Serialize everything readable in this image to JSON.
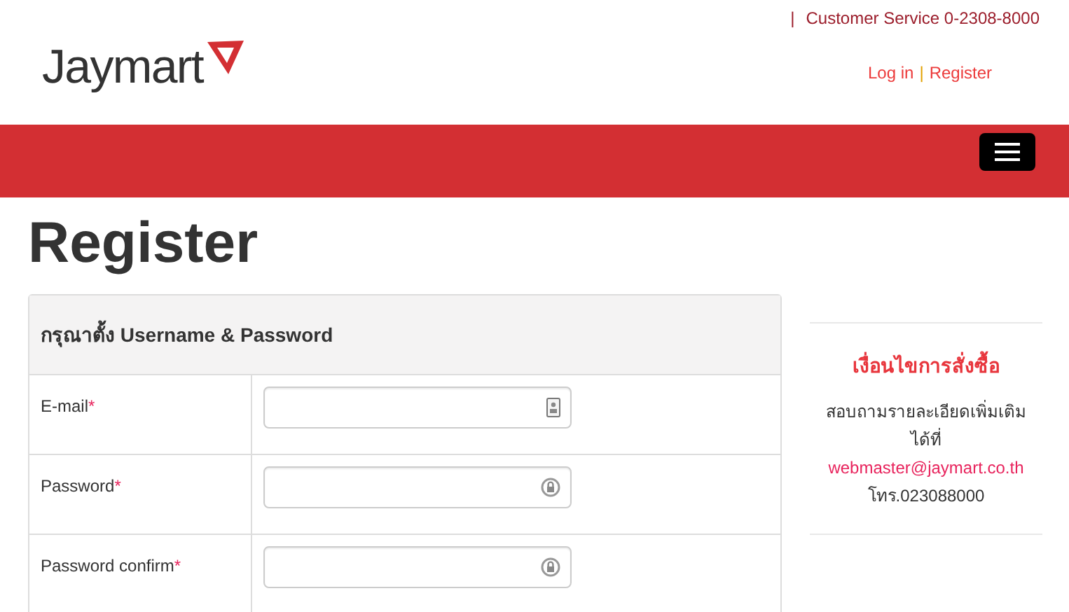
{
  "header": {
    "logo": "Jaymart",
    "separator": "|",
    "customer_service": "Customer Service 0-2308-8000",
    "links": [
      {
        "label": "Log in"
      },
      {
        "separator": "|",
        "label": "Register"
      }
    ]
  },
  "page_title": "Register",
  "form": {
    "heading": "กรุณาตั้ง Username & Password",
    "fields": [
      {
        "label": "E-mail",
        "required_mark": "*",
        "kind": "email"
      },
      {
        "label": "Password",
        "required_mark": "*",
        "kind": "password"
      },
      {
        "label": "Password confirm",
        "required_mark": "*",
        "kind": "password"
      }
    ]
  },
  "sidebar": {
    "title": "เงื่อนไขการสั่งซื้อ",
    "text_lines": [
      "สอบถามรายละเอียดเพิ่มเติม",
      "ได้ที่"
    ],
    "email": "webmaster@jaymart.co.th",
    "phone": "โทร.023088000"
  }
}
